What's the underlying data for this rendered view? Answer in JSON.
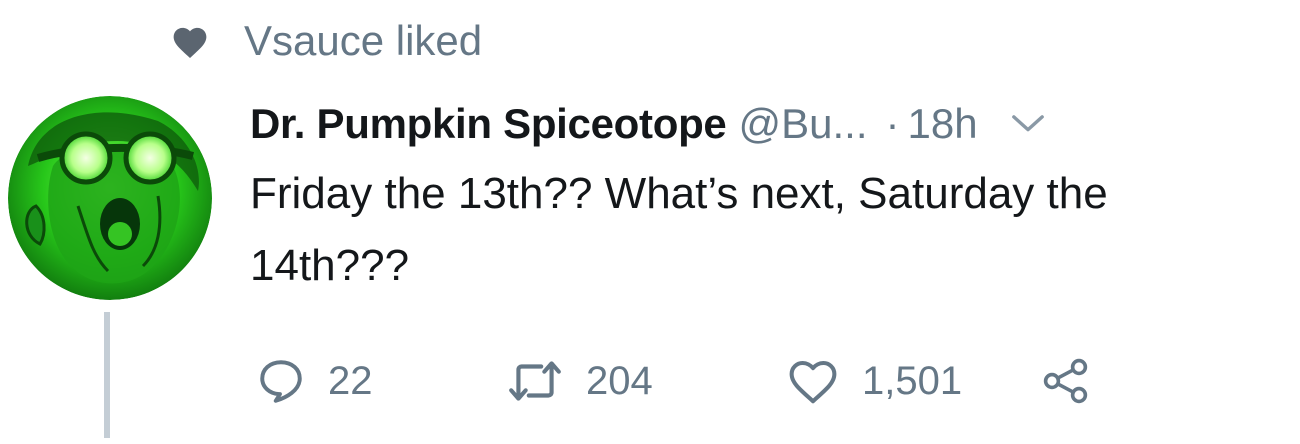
{
  "social_context": {
    "icon": "heart-filled-icon",
    "text": "Vsauce liked"
  },
  "tweet": {
    "display_name": "Dr. Pumpkin Spiceotope",
    "handle": "@Bu...",
    "separator": "·",
    "time": "18h",
    "text": "Friday the 13th?? What’s next, Saturday the 14th???",
    "avatar_icon": "avatar-image",
    "more_icon": "chevron-down-icon"
  },
  "actions": {
    "reply": {
      "icon": "reply-icon",
      "count": "22"
    },
    "retweet": {
      "icon": "retweet-icon",
      "count": "204"
    },
    "like": {
      "icon": "heart-outline-icon",
      "count": "1,501"
    },
    "share": {
      "icon": "share-icon"
    }
  },
  "colors": {
    "text_primary": "#14171a",
    "text_secondary": "#657786",
    "thread_line": "#c4cdd5",
    "avatar_green": "#2ecc1e"
  }
}
